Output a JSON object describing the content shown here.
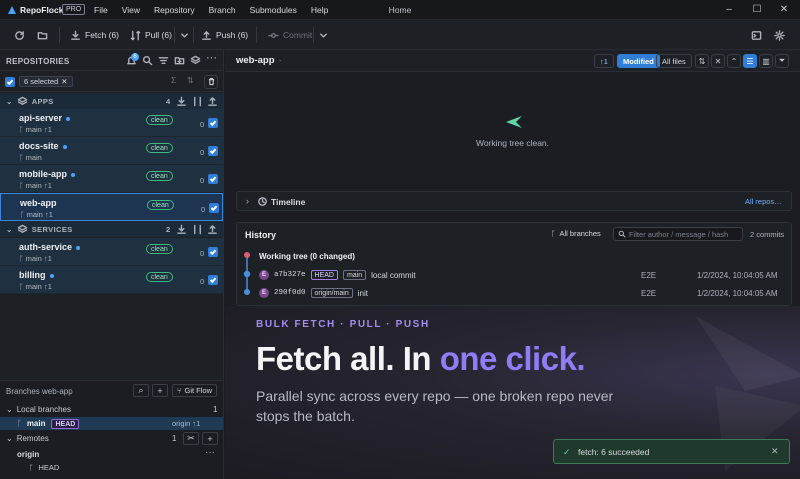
{
  "app": {
    "name": "RepoFlock",
    "edition": "PRO",
    "window_title": "Home"
  },
  "menu": [
    "File",
    "View",
    "Repository",
    "Branch",
    "Submodules",
    "Help"
  ],
  "toolbar": {
    "fetch": "Fetch (6)",
    "pull": "Pull (6)",
    "push": "Push (6)",
    "commit": "Commit"
  },
  "sidebar": {
    "title": "REPOSITORIES",
    "notif_count": "6",
    "selected": "6 selected",
    "groups": [
      {
        "name": "APPS",
        "count": "4"
      },
      {
        "name": "SERVICES",
        "count": "2"
      }
    ],
    "repos": [
      {
        "name": "api-server",
        "branch": "main",
        "ahead": "↑1",
        "status": "clean",
        "count": "0"
      },
      {
        "name": "docs-site",
        "branch": "main",
        "ahead": "",
        "status": "clean",
        "count": "0"
      },
      {
        "name": "mobile-app",
        "branch": "main",
        "ahead": "↑1",
        "status": "clean",
        "count": "0"
      },
      {
        "name": "web-app",
        "branch": "main",
        "ahead": "↑1",
        "status": "clean",
        "count": "0"
      },
      {
        "name": "auth-service",
        "branch": "main",
        "ahead": "↑1",
        "status": "clean",
        "count": "0"
      },
      {
        "name": "billing",
        "branch": "main",
        "ahead": "↑1",
        "status": "clean",
        "count": "0"
      }
    ]
  },
  "branches": {
    "title": "Branches web-app",
    "gitflow": "Git Flow",
    "local_label": "Local branches",
    "local_count": "1",
    "local": {
      "name": "main",
      "tag": "HEAD",
      "upstream": "origin ↑1"
    },
    "remotes_label": "Remotes",
    "remotes_count": "1",
    "remote": {
      "name": "origin",
      "branch": "HEAD"
    }
  },
  "main": {
    "repo": "web-app",
    "ahead": "↑1",
    "filter_modified": "Modified",
    "filter_all": "All files",
    "clean_text": "Working tree clean.",
    "timeline": "Timeline",
    "all_repos": "All repos…",
    "history": {
      "title": "History",
      "branches": "All branches",
      "filter_placeholder": "Filter author / message / hash",
      "commit_count": "2 commits",
      "working_tree": "Working tree (0 changed)",
      "commits": [
        {
          "avatar": "E",
          "hash": "a7b327e",
          "tags": [
            "HEAD",
            "main"
          ],
          "message": "local commit",
          "author": "E2E",
          "date": "1/2/2024, 10:04:05 AM"
        },
        {
          "avatar": "E",
          "hash": "290f0d0",
          "tags": [
            "origin/main"
          ],
          "message": "init",
          "author": "E2E",
          "date": "1/2/2024, 10:04:05 AM"
        }
      ]
    }
  },
  "promo": {
    "eyebrow": "BULK FETCH · PULL · PUSH",
    "headline_a": "Fetch all. In ",
    "headline_b": "one click.",
    "sub": "Parallel sync across every repo — one broken repo never stops the batch."
  },
  "toast": {
    "text": "fetch: 6 succeeded"
  },
  "colors": {
    "accent": "#2f7fd9",
    "promo_accent": "#8f7cf6",
    "clean_badge": "#3fb878",
    "toast_bg": "#1f3a2c"
  }
}
